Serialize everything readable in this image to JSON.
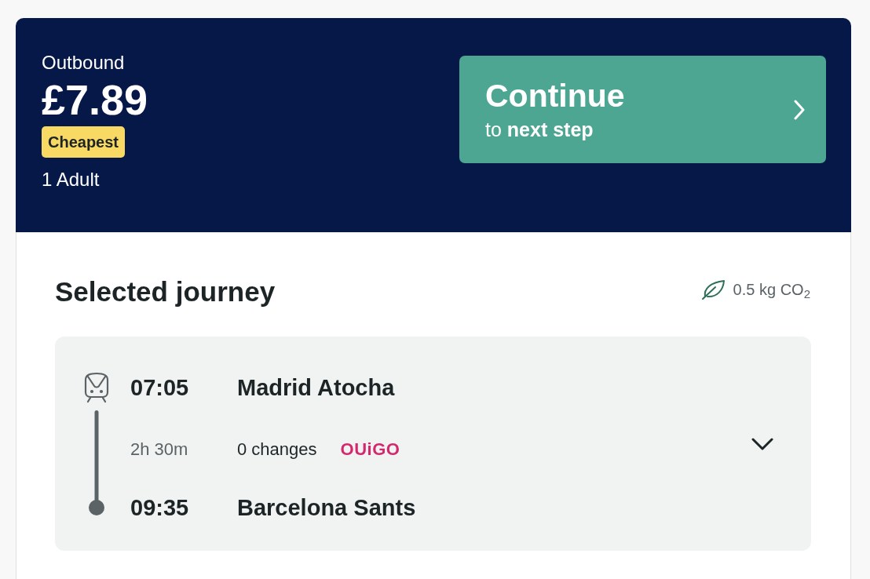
{
  "header": {
    "direction": "Outbound",
    "price": "£7.89",
    "badge": "Cheapest",
    "passengers": "1 Adult"
  },
  "continue_button": {
    "title": "Continue",
    "subtitle": "to **next step**"
  },
  "journey": {
    "heading": "Selected journey",
    "emissions": "0.5 kg CO$_{2}$",
    "departure": {
      "time": "07:05",
      "station": "Madrid Atocha"
    },
    "duration": "2h 30m",
    "changes": "0 changes",
    "operator": "OUiGO",
    "arrival": {
      "time": "09:35",
      "station": "Barcelona Sants"
    },
    "expanded": false
  }
}
